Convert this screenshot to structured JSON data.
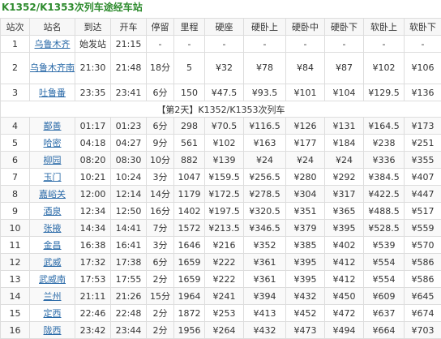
{
  "title": "K1352/K1353次列车途经车站",
  "headers": [
    "站次",
    "站名",
    "到达",
    "开车",
    "停留",
    "里程",
    "硬座",
    "硬卧上",
    "硬卧中",
    "硬卧下",
    "软卧上",
    "软卧下"
  ],
  "day_label": "【第2天】K1352/K1353次列车",
  "rows": [
    [
      "1",
      "乌鲁木齐",
      "始发站",
      "21:15",
      "-",
      "-",
      "-",
      "-",
      "-",
      "-",
      "-",
      "-"
    ],
    [
      "2",
      "乌鲁木齐南",
      "21:30",
      "21:48",
      "18分",
      "5",
      "¥32",
      "¥78",
      "¥84",
      "¥87",
      "¥102",
      "¥106"
    ],
    [
      "3",
      "吐鲁番",
      "23:35",
      "23:41",
      "6分",
      "150",
      "¥47.5",
      "¥93.5",
      "¥101",
      "¥104",
      "¥129.5",
      "¥136"
    ],
    [
      "4",
      "鄯善",
      "01:17",
      "01:23",
      "6分",
      "298",
      "¥70.5",
      "¥116.5",
      "¥126",
      "¥131",
      "¥164.5",
      "¥173"
    ],
    [
      "5",
      "哈密",
      "04:18",
      "04:27",
      "9分",
      "561",
      "¥102",
      "¥163",
      "¥177",
      "¥184",
      "¥238",
      "¥251"
    ],
    [
      "6",
      "柳园",
      "08:20",
      "08:30",
      "10分",
      "882",
      "¥139",
      "¥24",
      "¥24",
      "¥24",
      "¥336",
      "¥355"
    ],
    [
      "7",
      "玉门",
      "10:21",
      "10:24",
      "3分",
      "1047",
      "¥159.5",
      "¥256.5",
      "¥280",
      "¥292",
      "¥384.5",
      "¥407"
    ],
    [
      "8",
      "嘉峪关",
      "12:00",
      "12:14",
      "14分",
      "1179",
      "¥172.5",
      "¥278.5",
      "¥304",
      "¥317",
      "¥422.5",
      "¥447"
    ],
    [
      "9",
      "酒泉",
      "12:34",
      "12:50",
      "16分",
      "1402",
      "¥197.5",
      "¥320.5",
      "¥351",
      "¥365",
      "¥488.5",
      "¥517"
    ],
    [
      "10",
      "张掖",
      "14:34",
      "14:41",
      "7分",
      "1572",
      "¥213.5",
      "¥346.5",
      "¥379",
      "¥395",
      "¥528.5",
      "¥559"
    ],
    [
      "11",
      "金昌",
      "16:38",
      "16:41",
      "3分",
      "1646",
      "¥216",
      "¥352",
      "¥385",
      "¥402",
      "¥539",
      "¥570"
    ],
    [
      "12",
      "武威",
      "17:32",
      "17:38",
      "6分",
      "1659",
      "¥222",
      "¥361",
      "¥395",
      "¥412",
      "¥554",
      "¥586"
    ],
    [
      "13",
      "武威南",
      "17:53",
      "17:55",
      "2分",
      "1659",
      "¥222",
      "¥361",
      "¥395",
      "¥412",
      "¥554",
      "¥586"
    ],
    [
      "14",
      "兰州",
      "21:11",
      "21:26",
      "15分",
      "1964",
      "¥241",
      "¥394",
      "¥432",
      "¥450",
      "¥609",
      "¥645"
    ],
    [
      "15",
      "定西",
      "22:46",
      "22:48",
      "2分",
      "1872",
      "¥253",
      "¥413",
      "¥452",
      "¥472",
      "¥637",
      "¥674"
    ],
    [
      "16",
      "陇西",
      "23:42",
      "23:44",
      "2分",
      "1956",
      "¥264",
      "¥432",
      "¥473",
      "¥494",
      "¥664",
      "¥703"
    ]
  ]
}
